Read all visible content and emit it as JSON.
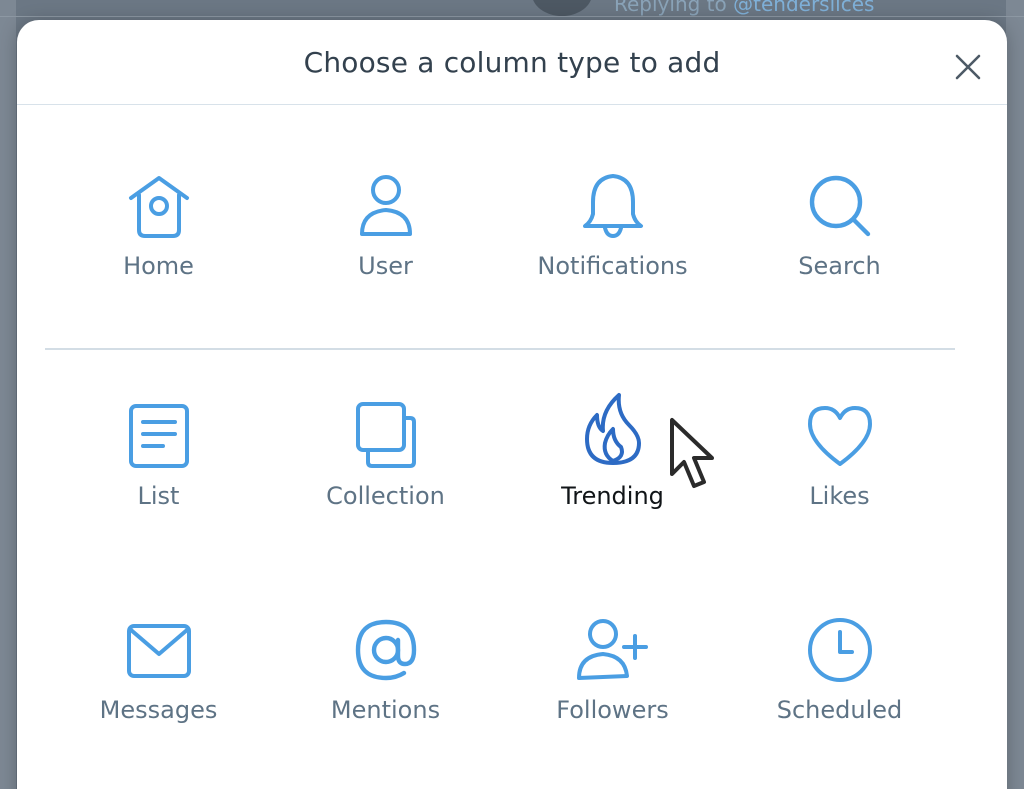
{
  "background": {
    "reply_prefix": "Replying to",
    "reply_handle": "@tenderslices"
  },
  "modal": {
    "title": "Choose a column type to add",
    "close_icon": "close-icon"
  },
  "colors": {
    "icon_blue": "#4a9ee3",
    "icon_active": "#2d6bc4",
    "label_gray": "#5e7385",
    "label_active": "#111518",
    "divider": "#d3dde5"
  },
  "column_types": [
    {
      "label": "Home",
      "icon": "birdhouse-icon"
    },
    {
      "label": "User",
      "icon": "user-icon"
    },
    {
      "label": "Notifications",
      "icon": "bell-icon"
    },
    {
      "label": "Search",
      "icon": "search-icon"
    },
    {
      "label": "List",
      "icon": "list-icon"
    },
    {
      "label": "Collection",
      "icon": "collection-icon"
    },
    {
      "label": "Trending",
      "icon": "flame-icon",
      "active": true
    },
    {
      "label": "Likes",
      "icon": "heart-icon"
    },
    {
      "label": "Messages",
      "icon": "envelope-icon"
    },
    {
      "label": "Mentions",
      "icon": "at-icon"
    },
    {
      "label": "Followers",
      "icon": "add-user-icon"
    },
    {
      "label": "Scheduled",
      "icon": "clock-icon"
    }
  ]
}
